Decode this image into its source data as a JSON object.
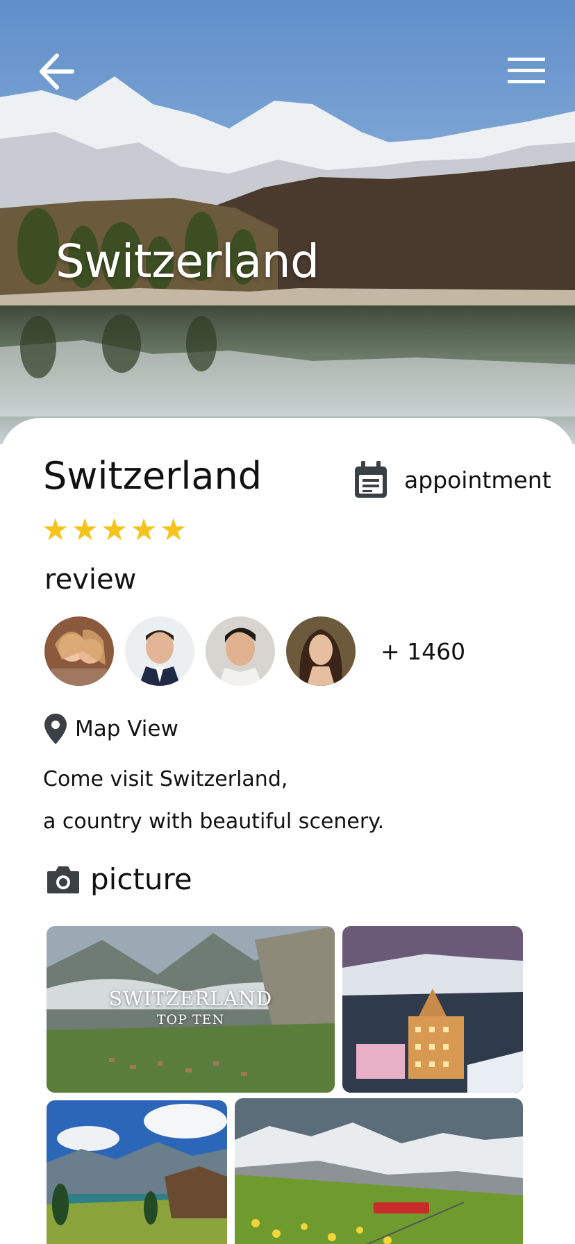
{
  "hero": {
    "title": "Switzerland",
    "back_icon": "arrow-left-icon",
    "menu_icon": "hamburger-menu-icon"
  },
  "details": {
    "title": "Switzerland",
    "appointment_label": "appointment",
    "appointment_icon": "calendar-note-icon",
    "rating": 5,
    "rating_max": 5,
    "star_color": "#f6c21c"
  },
  "reviews": {
    "label": "review",
    "count_text": "+ 1460",
    "avatar_count": 4
  },
  "map": {
    "label": "Map View",
    "icon": "map-pin-icon"
  },
  "description": {
    "line1": "Come visit Switzerland,",
    "line2": "a country with beautiful scenery."
  },
  "pictures": {
    "label": "picture",
    "icon": "camera-icon",
    "photo1_caption_line1": "SWITZERLAND",
    "photo1_caption_line2": "TOP TEN"
  }
}
